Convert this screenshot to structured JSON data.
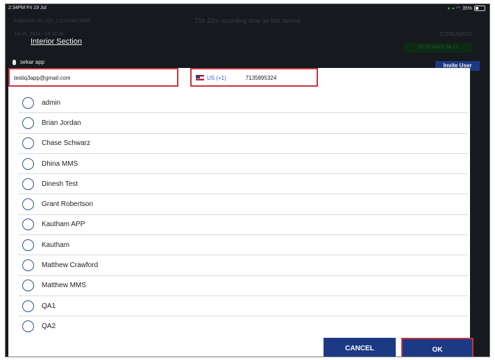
{
  "status_bar": {
    "time": "2:34PM  Fri 19 Jul",
    "battery": "35%"
  },
  "header": {
    "inspection_id": "Inspection ID: IQ3_1721378076893",
    "date": "Jul 19, 2024 - 14:19:38",
    "recording_time": "71h 22m recording time on this device",
    "section_title": "Interior Section",
    "streaming_label": "STREAMING",
    "timer": "00:03:48/00:34:11",
    "user_name": "sekar app",
    "invite_label": "Invite User"
  },
  "form": {
    "email": "testiq3app@gmail.com",
    "country_code": "US (+1)",
    "phone": "7135895324"
  },
  "users": [
    {
      "name": "admin"
    },
    {
      "name": "Brian Jordan"
    },
    {
      "name": "Chase Schwarz"
    },
    {
      "name": "Dhina MMS"
    },
    {
      "name": "Dinesh Test"
    },
    {
      "name": "Grant Robertson"
    },
    {
      "name": "Kautham APP"
    },
    {
      "name": "Kautham"
    },
    {
      "name": "Matthew Crawford"
    },
    {
      "name": "Matthew MMS"
    },
    {
      "name": "QA1"
    },
    {
      "name": "QA2"
    }
  ],
  "buttons": {
    "cancel": "CANCEL",
    "ok": "OK"
  },
  "colors": {
    "accent": "#1c3a83",
    "highlight_border": "#c8313f",
    "background": "#16191d"
  }
}
